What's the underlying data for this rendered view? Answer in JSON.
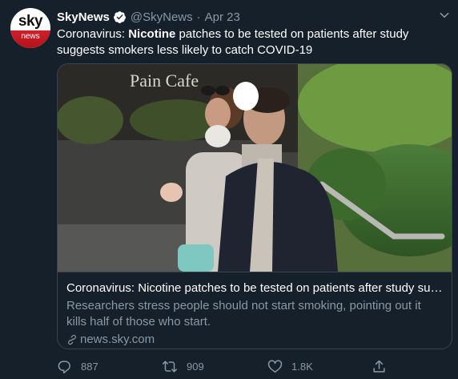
{
  "account": {
    "avatar_top": "sky",
    "avatar_bottom": "news",
    "display_name": "SkyNews",
    "handle": "@SkyNews",
    "separator": "·",
    "date": "Apr 23"
  },
  "tweet": {
    "text_before": "Coronavirus: ",
    "text_bold": "Nicotine",
    "text_after": " patches to be tested on patients after study suggests smokers less likely to catch COVID-19"
  },
  "card": {
    "image_caption_sign": "Pain Cafe",
    "title": "Coronavirus: Nicotine patches to be tested on patients after study sug...",
    "description": "Researchers stress people should not start smoking, pointing out it kills half of those who start.",
    "domain": "news.sky.com"
  },
  "actions": {
    "replies": "887",
    "retweets": "909",
    "likes": "1.8K"
  },
  "colors": {
    "background": "#15202b",
    "border": "#38444d",
    "secondary_text": "#8899a6",
    "verified": "#ffffff",
    "sky_red": "#c8141f"
  },
  "icons": [
    "verified-icon",
    "chevron-down-icon",
    "link-icon",
    "reply-icon",
    "retweet-icon",
    "like-icon",
    "share-icon"
  ]
}
